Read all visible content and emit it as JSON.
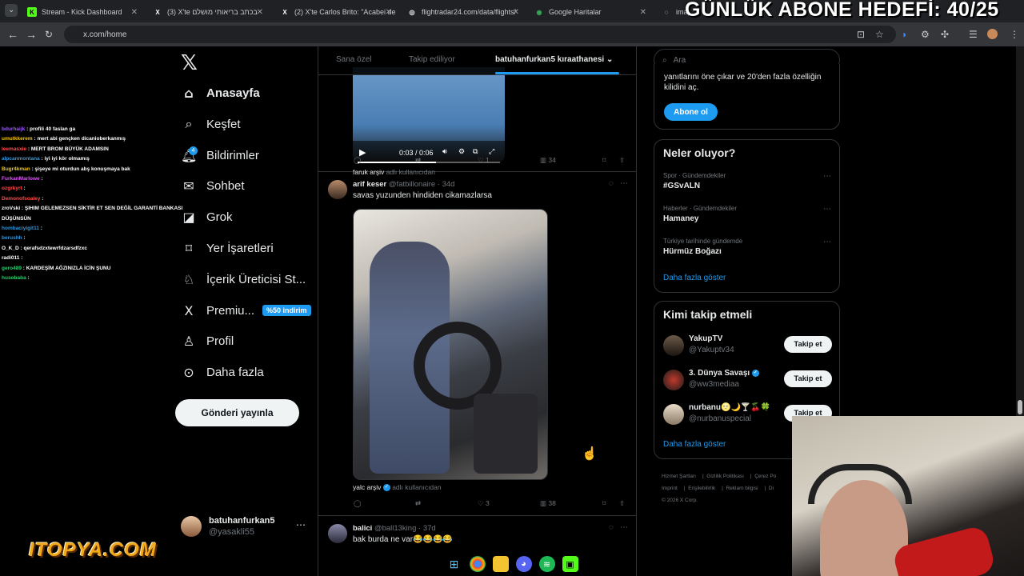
{
  "browser": {
    "tabs": [
      {
        "label": "Stream - Kick Dashboard",
        "fav": "K",
        "fav_color": "#53fc18"
      },
      {
        "label": "(3) X'te בכתב בריאותי מושלם",
        "fav": "X",
        "fav_color": "#ffffff"
      },
      {
        "label": "(2) X'te Carlos Brito: \"Acabei de",
        "fav": "X",
        "fav_color": "#ffffff"
      },
      {
        "label": "flightradar24.com/data/flights/",
        "fav": "◎",
        "fav_color": "#ffffff"
      },
      {
        "label": "Google Haritalar",
        "fav": "◉",
        "fav_color": "#34a853"
      },
      {
        "label": "imag",
        "fav": "◌",
        "fav_color": "#ffffff"
      }
    ],
    "url": "x.com/home"
  },
  "overlay": {
    "goal_text": "GÜNLÜK ABONE HEDEFİ: 40/25",
    "sponsor": "ITOPYA.COM",
    "chat": [
      {
        "user": "bdurhaijk",
        "msg": "profili 40 faslan ga",
        "color": "#9b59ff"
      },
      {
        "user": "umutkkerem",
        "msg": "mert abi gençken dicanioberkanmış",
        "color": "#f1c40f"
      },
      {
        "user": "leemasxie",
        "msg": "MERT BROM BÜYÜK ADAMSIN",
        "color": "#ff4d4d"
      },
      {
        "user": "alpcanmontana",
        "msg": "iyi iyi kör olmamış",
        "color": "#3498db"
      },
      {
        "user": "Bugr4kman",
        "msg": "şişeye mi oturdun abş konuşmaya bak",
        "color": "#f1c40f"
      },
      {
        "user": "FurkanMarlowe",
        "msg": "",
        "color": "#e056fd"
      },
      {
        "user": "ozgrkyrt",
        "msg": "",
        "color": "#ff4d4d"
      },
      {
        "user": "Demonofsoaley",
        "msg": "",
        "color": "#ff4d4d"
      },
      {
        "user": "zroVski",
        "msg": "ŞIHIM GELEMEZSEN SİKTİR ET SEN DEĞİL GARANTİ BANKASI",
        "color": "#ffffff"
      },
      {
        "user": "",
        "msg": "DÜŞÜNSÜN",
        "color": "#ffffff"
      },
      {
        "user": "hombaciyigit11",
        "msg": "",
        "color": "#3498db"
      },
      {
        "user": "berushh",
        "msg": "",
        "color": "#3498db"
      },
      {
        "user": "O_K_D",
        "msg": "qerafsdzxtewrfdzarsdfzxc",
        "color": "#ffffff"
      },
      {
        "user": "radi011",
        "msg": "",
        "color": "#ffffff"
      },
      {
        "user": "gero489",
        "msg": "KARDEŞİM AĞZINIZLA İCİN ŞUNU",
        "color": "#2ecc71"
      },
      {
        "user": "husobaba",
        "msg": "",
        "color": "#2ecc71"
      }
    ]
  },
  "nav": {
    "items": [
      {
        "label": "Anasayfa",
        "icon": "⌂",
        "name": "home"
      },
      {
        "label": "Keşfet",
        "icon": "⌕",
        "name": "explore"
      },
      {
        "label": "Bildirimler",
        "icon": "♫",
        "name": "notifications"
      },
      {
        "label": "Sohbet",
        "icon": "✉",
        "name": "chat"
      },
      {
        "label": "Grok",
        "icon": "◪",
        "name": "grok"
      },
      {
        "label": "Yer İşaretleri",
        "icon": "⌑",
        "name": "bookmarks"
      },
      {
        "label": "İçerik Üreticisi St...",
        "icon": "⚇",
        "name": "creator-studio"
      },
      {
        "label": "Premiu...",
        "icon": "X",
        "name": "premium"
      },
      {
        "label": "Profil",
        "icon": "♙",
        "name": "profile"
      },
      {
        "label": "Daha fazla",
        "icon": "⋯",
        "name": "more"
      }
    ],
    "notif_count": "4",
    "premium_promo": "%50 indirim",
    "post_button": "Gönderi yayınla",
    "account_name": "batuhanfurkan5",
    "account_handle": "@yasakli55"
  },
  "timeline": {
    "tabs": [
      "Sana özel",
      "Takip ediliyor",
      "batuhanfurkan5 kıraathanesi"
    ],
    "post0": {
      "video_time": "0:03 / 0:06",
      "video_progress": 0.55,
      "attr_user": "faruk arşiv",
      "attr_suffix": "adlı kullanıcıdan",
      "likes": "1",
      "views": "34"
    },
    "post1": {
      "name": "arif keser",
      "handle": "@fatbillonaire",
      "time": "· 34d",
      "text": "savas yuzunden hindiden cikamazlarsa",
      "attr_user": "yalc arşiv",
      "attr_suffix": "adlı kullanıcıdan",
      "likes": "3",
      "views": "38"
    },
    "post2": {
      "name": "balici",
      "handle": "@ball13king",
      "time": "· 37d",
      "text": "bak burda ne var😂😂😂😂"
    }
  },
  "sidebar": {
    "search_placeholder": "Ara",
    "premium_text": "yanıtlarını öne çıkar ve 20'den fazla özelliğin kilidini aç.",
    "subscribe": "Abone ol",
    "trends_title": "Neler oluyor?",
    "trends": [
      {
        "meta": "Spor · Gündemdekiler",
        "title": "#GSvALN"
      },
      {
        "meta": "Haberler · Gündemdekiler",
        "title": "Hamaney"
      },
      {
        "meta": "Türkiye tarihinde gündemde",
        "title": "Hürmüz Boğazı"
      }
    ],
    "show_more": "Daha fazla göster",
    "follow_title": "Kimi takip etmeli",
    "who": [
      {
        "name": "YakupTV",
        "handle": "@Yakuptv34",
        "verified": false
      },
      {
        "name": "3. Dünya Savaşı",
        "handle": "@ww3mediaa",
        "verified": true
      },
      {
        "name": "nurbanu🌝🌙🍸🍒🍀",
        "handle": "@nurbanuspecial",
        "verified": false
      }
    ],
    "follow_label": "Takip et",
    "footer": [
      "Hizmet Şartları",
      "Gizlilik Politikası",
      "Çerez Po",
      "Imprint",
      "Erişilebilirlik",
      "Reklam bilgisi",
      "Di",
      "© 2026 X Corp."
    ]
  }
}
